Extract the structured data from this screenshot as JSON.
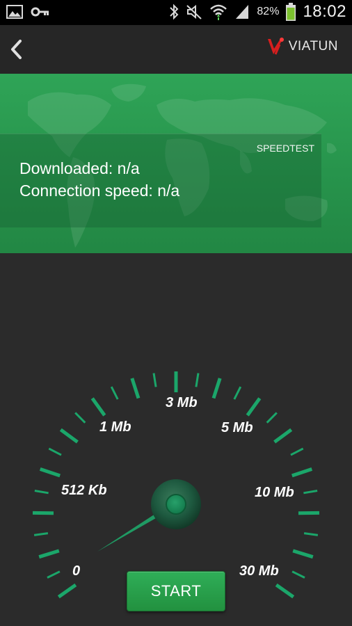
{
  "status_bar": {
    "battery_percent": "82%",
    "time": "18:02",
    "icons": [
      "image-icon",
      "key-icon",
      "bluetooth-icon",
      "mute-icon",
      "wifi-icon",
      "signal-icon",
      "battery-icon"
    ]
  },
  "app_bar": {
    "logo_text": "VIATUN",
    "back_icon": "chevron-left-icon"
  },
  "banner": {
    "label": "SPEEDTEST",
    "downloaded": "Downloaded: n/a",
    "connection_speed": "Connection speed: n/a"
  },
  "gauge": {
    "labels": {
      "zero": "0",
      "kb512": "512 Kb",
      "mb1": "1 Mb",
      "mb3": "3 Mb",
      "mb5": "5 Mb",
      "mb10": "10 Mb",
      "mb30": "30 Mb"
    },
    "needle_value": "0"
  },
  "start_button": {
    "label": "START"
  },
  "colors": {
    "accent_green": "#2fa457",
    "tick_green": "#1ba66a",
    "background": "#2b2b2b"
  }
}
